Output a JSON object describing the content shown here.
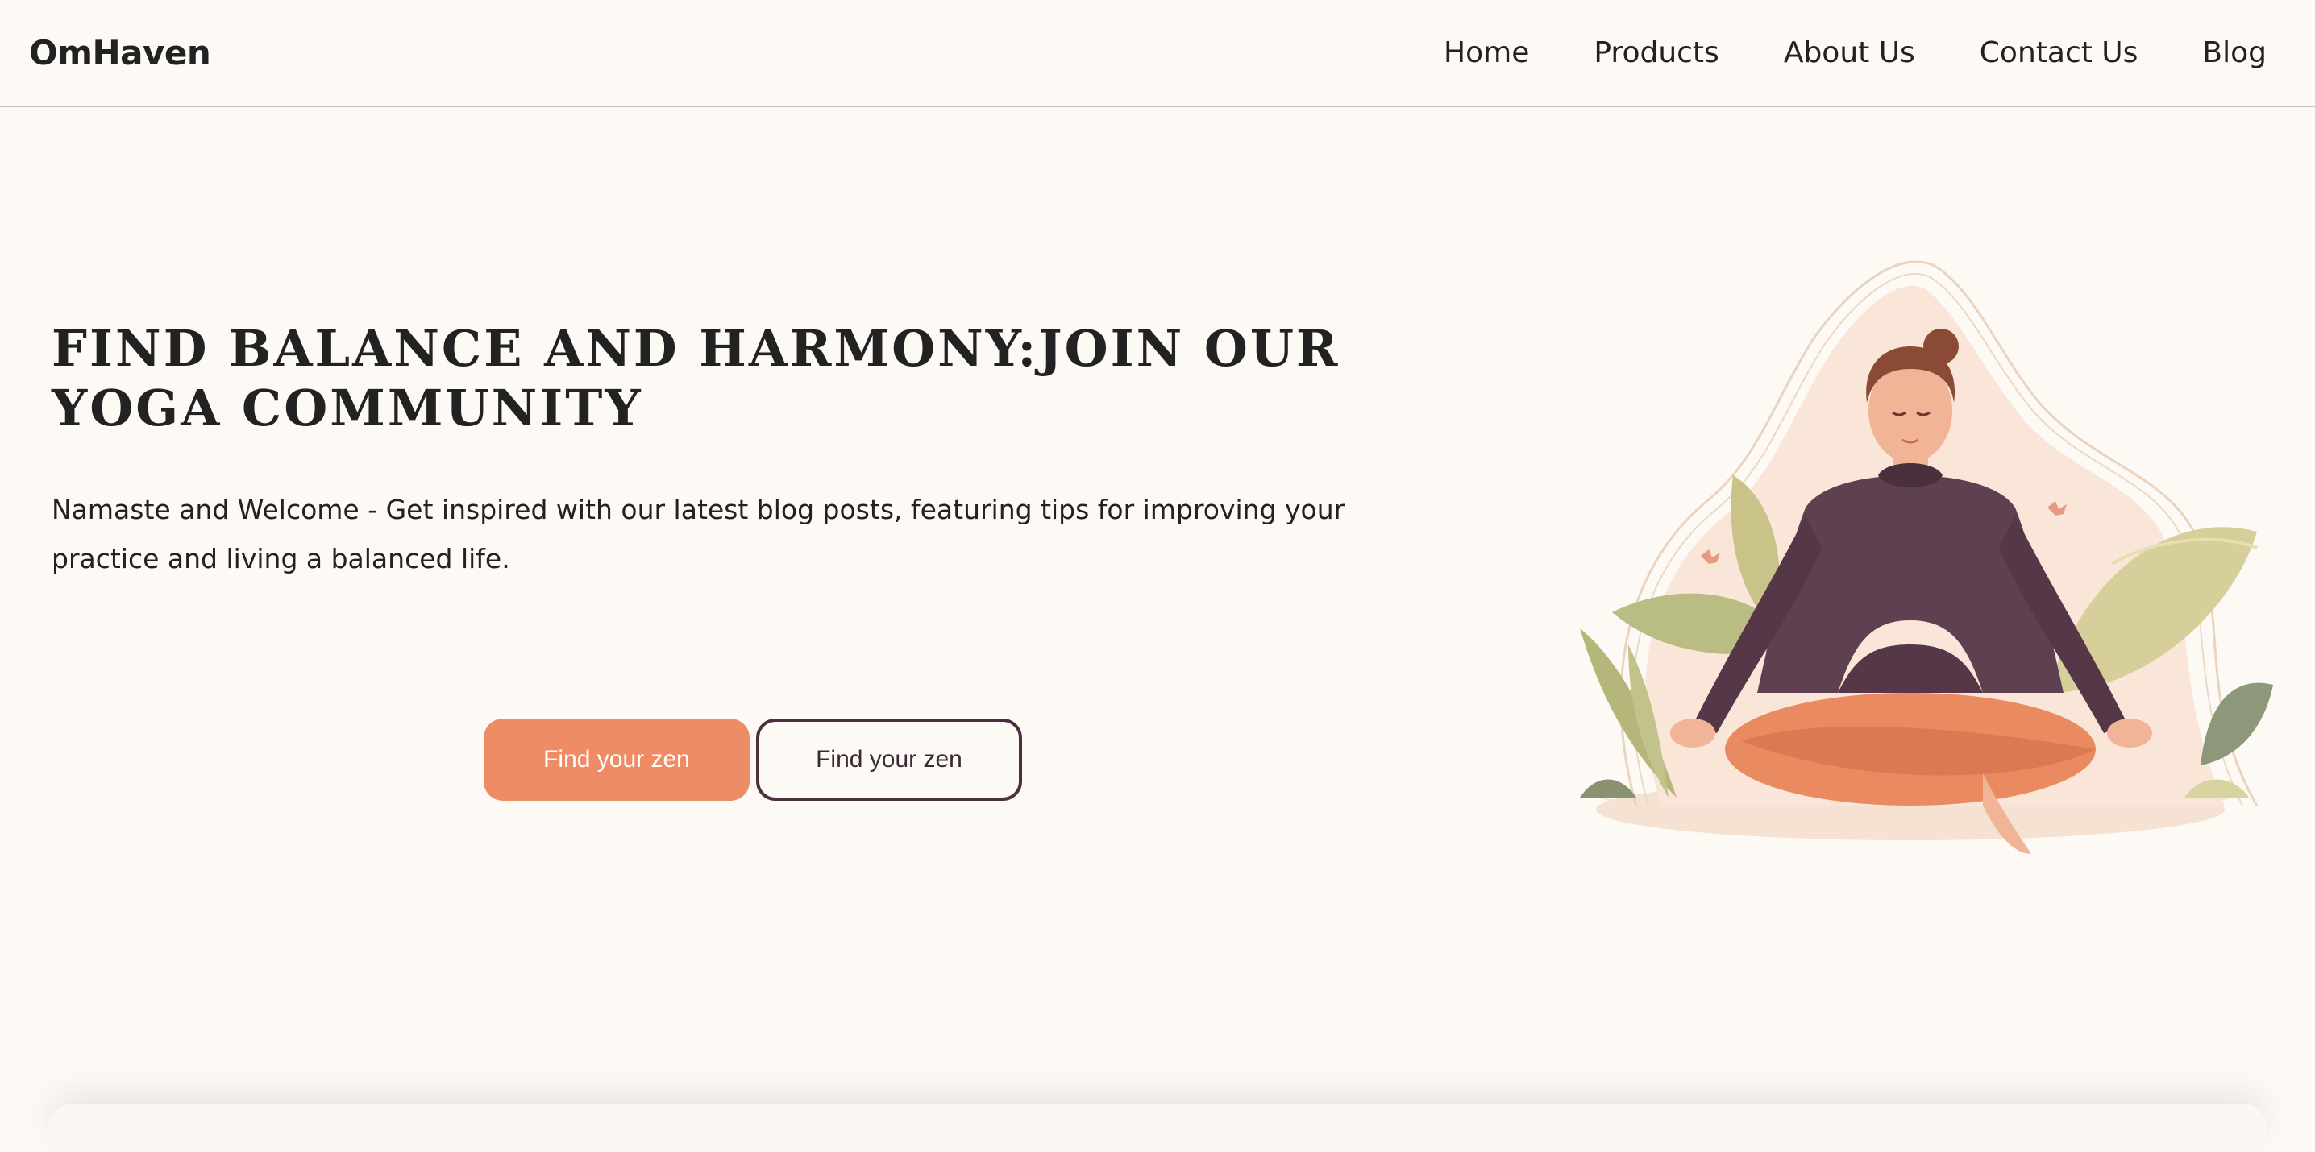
{
  "brand": {
    "name": "OmHaven"
  },
  "nav": {
    "items": [
      {
        "label": "Home"
      },
      {
        "label": "Products"
      },
      {
        "label": "About Us"
      },
      {
        "label": "Contact Us"
      },
      {
        "label": "Blog"
      }
    ]
  },
  "hero": {
    "title": "Find Balance and Harmony:Join Our Yoga Community",
    "subtitle": "Namaste and Welcome - Get inspired with our latest blog posts, featuring tips for improving your practice and living a balanced life.",
    "primary_button": "Find your zen",
    "secondary_button": "Find your zen",
    "illustration_icon": "meditating-woman-illustration"
  },
  "colors": {
    "background": "#fdf9f4",
    "accent": "#ee8c66",
    "dark_accent": "#4a3040",
    "text": "#222222",
    "leaf_green": "#b9bd84",
    "leaf_beige": "#d6cf9a"
  }
}
